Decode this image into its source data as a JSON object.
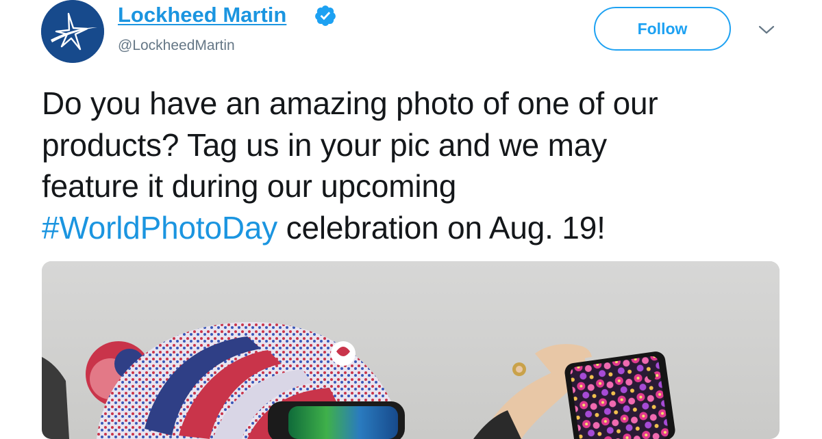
{
  "account": {
    "display_name": "Lockheed Martin",
    "handle": "@LockheedMartin",
    "verified": true,
    "avatar_icon": "lockheed-star-logo",
    "brand_color": "#174a8c"
  },
  "actions": {
    "follow_label": "Follow",
    "menu_icon": "chevron-down-icon",
    "accent_color": "#1da1f2"
  },
  "tweet": {
    "line1": "Do you have an amazing photo of one of our",
    "line2": "products? Tag us in your pic and we may",
    "line3": "feature it during our upcoming",
    "hashtag": "#WorldPhotoDay",
    "line4_rest": " celebration on Aug. 19!"
  },
  "media": {
    "icon": "photo-person-knit-hat-goggles-phone"
  }
}
